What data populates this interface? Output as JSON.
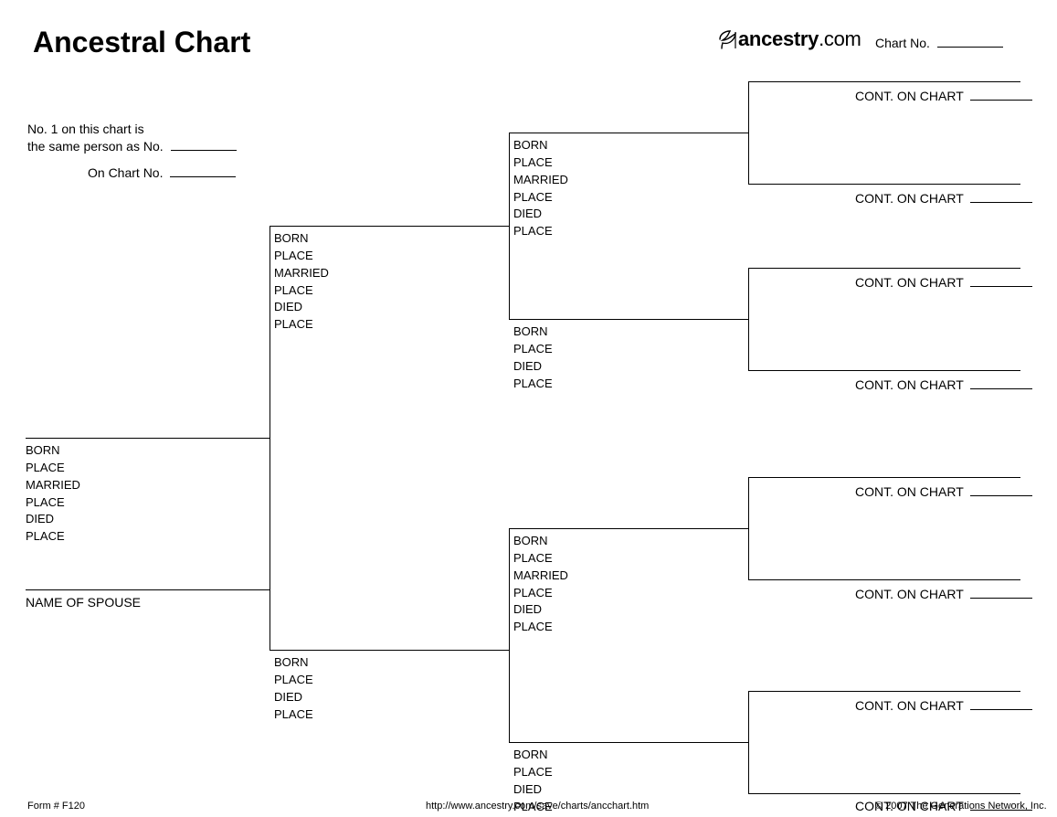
{
  "title": "Ancestral Chart",
  "brand_prefix": "ancestry",
  "brand_suffix": ".com",
  "chart_no_label": "Chart No.",
  "note_line1": "No. 1 on this chart is",
  "note_line2": "the same person as No.",
  "note_line3": "On Chart No.",
  "spouse_label": "NAME OF SPOUSE",
  "fields_full": [
    "BORN",
    "PLACE",
    "MARRIED",
    "PLACE",
    "DIED",
    "PLACE"
  ],
  "fields_short": [
    "BORN",
    "PLACE",
    "DIED",
    "PLACE"
  ],
  "cont_label": "CONT. ON CHART",
  "footer_left": "Form # F120",
  "footer_center": "http://www.ancestry.com/save/charts/ancchart.htm",
  "footer_right": "© 2007 The Generations Network, Inc."
}
